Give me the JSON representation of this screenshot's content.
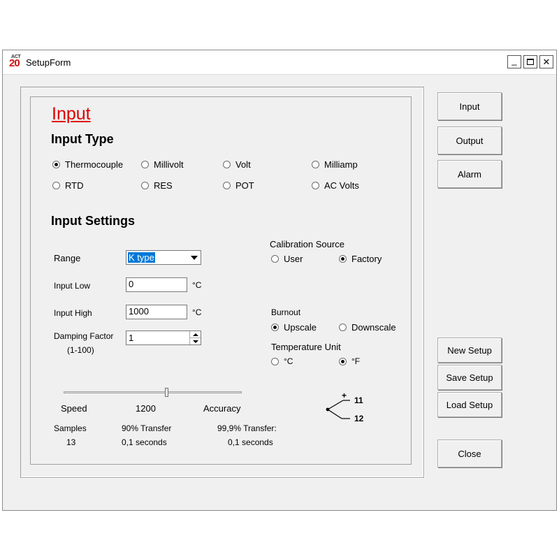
{
  "window": {
    "title": "SetupForm",
    "icon_top": "ACT",
    "icon_num": "20",
    "controls": [
      "_",
      "☐",
      "✕"
    ]
  },
  "input": {
    "title": "Input",
    "type_heading": "Input Type",
    "types": [
      {
        "label": "Thermocouple",
        "selected": true
      },
      {
        "label": "Millivolt",
        "selected": false
      },
      {
        "label": "Volt",
        "selected": false
      },
      {
        "label": "Milliamp",
        "selected": false
      },
      {
        "label": "RTD",
        "selected": false
      },
      {
        "label": "RES",
        "selected": false
      },
      {
        "label": "POT",
        "selected": false
      },
      {
        "label": "AC Volts",
        "selected": false
      }
    ],
    "settings_heading": "Input Settings"
  },
  "settings": {
    "range_label": "Range",
    "range_value": "K type",
    "input_low_label": "Input Low",
    "input_low_value": "0",
    "input_low_unit": "°C",
    "input_high_label": "Input High",
    "input_high_value": "1000",
    "input_high_unit": "°C",
    "damping_label": "Damping Factor",
    "damping_range": "(1-100)",
    "damping_value": "1"
  },
  "calibration": {
    "label": "Calibration Source",
    "options": [
      {
        "label": "User",
        "selected": false
      },
      {
        "label": "Factory",
        "selected": true
      }
    ]
  },
  "burnout": {
    "label": "Burnout",
    "options": [
      {
        "label": "Upscale",
        "selected": true
      },
      {
        "label": "Downscale",
        "selected": false
      }
    ]
  },
  "temperature_unit": {
    "label": "Temperature Unit",
    "options": [
      {
        "label": "°C",
        "selected": false
      },
      {
        "label": "°F",
        "selected": true
      }
    ]
  },
  "slider": {
    "min_label": "Speed",
    "value_label": "1200",
    "max_label": "Accuracy",
    "position_fraction": 0.58
  },
  "stats": {
    "samples_label": "Samples",
    "samples_value": "13",
    "transfer90_label": "90% Transfer",
    "transfer90_value": "0,1 seconds",
    "transfer999_label": "99,9% Transfer:",
    "transfer999_value": "0,1 seconds"
  },
  "terminal": {
    "plus": "+",
    "minus": "-",
    "pin_pos": "11",
    "pin_neg": "12"
  },
  "buttons": {
    "input": "Input",
    "output": "Output",
    "alarm": "Alarm",
    "new_setup": "New Setup",
    "save_setup": "Save Setup",
    "load_setup": "Load Setup",
    "close": "Close"
  }
}
